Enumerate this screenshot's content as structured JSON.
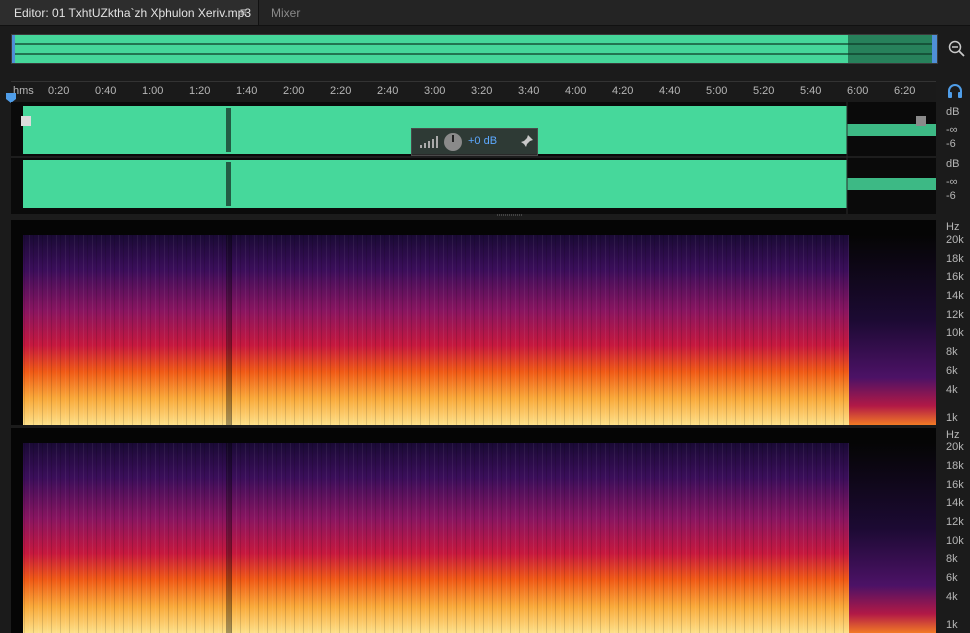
{
  "tabs": {
    "editor_label": "Editor: 01 TxhtUZktha`zh Xþhulon Xeriv.mp3",
    "mixer_label": "Mixer"
  },
  "ruler": {
    "unit_label": "hms",
    "labels": [
      "0:20",
      "0:40",
      "1:00",
      "1:20",
      "1:40",
      "2:00",
      "2:20",
      "2:40",
      "3:00",
      "3:20",
      "3:40",
      "4:00",
      "4:20",
      "4:40",
      "5:00",
      "5:20",
      "5:40",
      "6:00",
      "6:20"
    ]
  },
  "waveform": {
    "color": "#44d89a",
    "ch1_db_unit": "dB",
    "ch1_db_ticks": [
      "-∞",
      "-6"
    ],
    "ch2_db_unit": "dB",
    "ch2_db_ticks": [
      "-∞",
      "-6"
    ]
  },
  "hud": {
    "volume": "+0 dB"
  },
  "spectrogram": {
    "unit": "Hz",
    "labels": [
      "20k",
      "18k",
      "16k",
      "14k",
      "12k",
      "10k",
      "8k",
      "6k",
      "4k",
      "1k"
    ]
  },
  "icons": {
    "menu": "hamburger-icon",
    "zoom": "zoom-out-icon",
    "monitor": "headphone-icon",
    "pin": "pin-icon",
    "level": "level-meter-icon"
  }
}
